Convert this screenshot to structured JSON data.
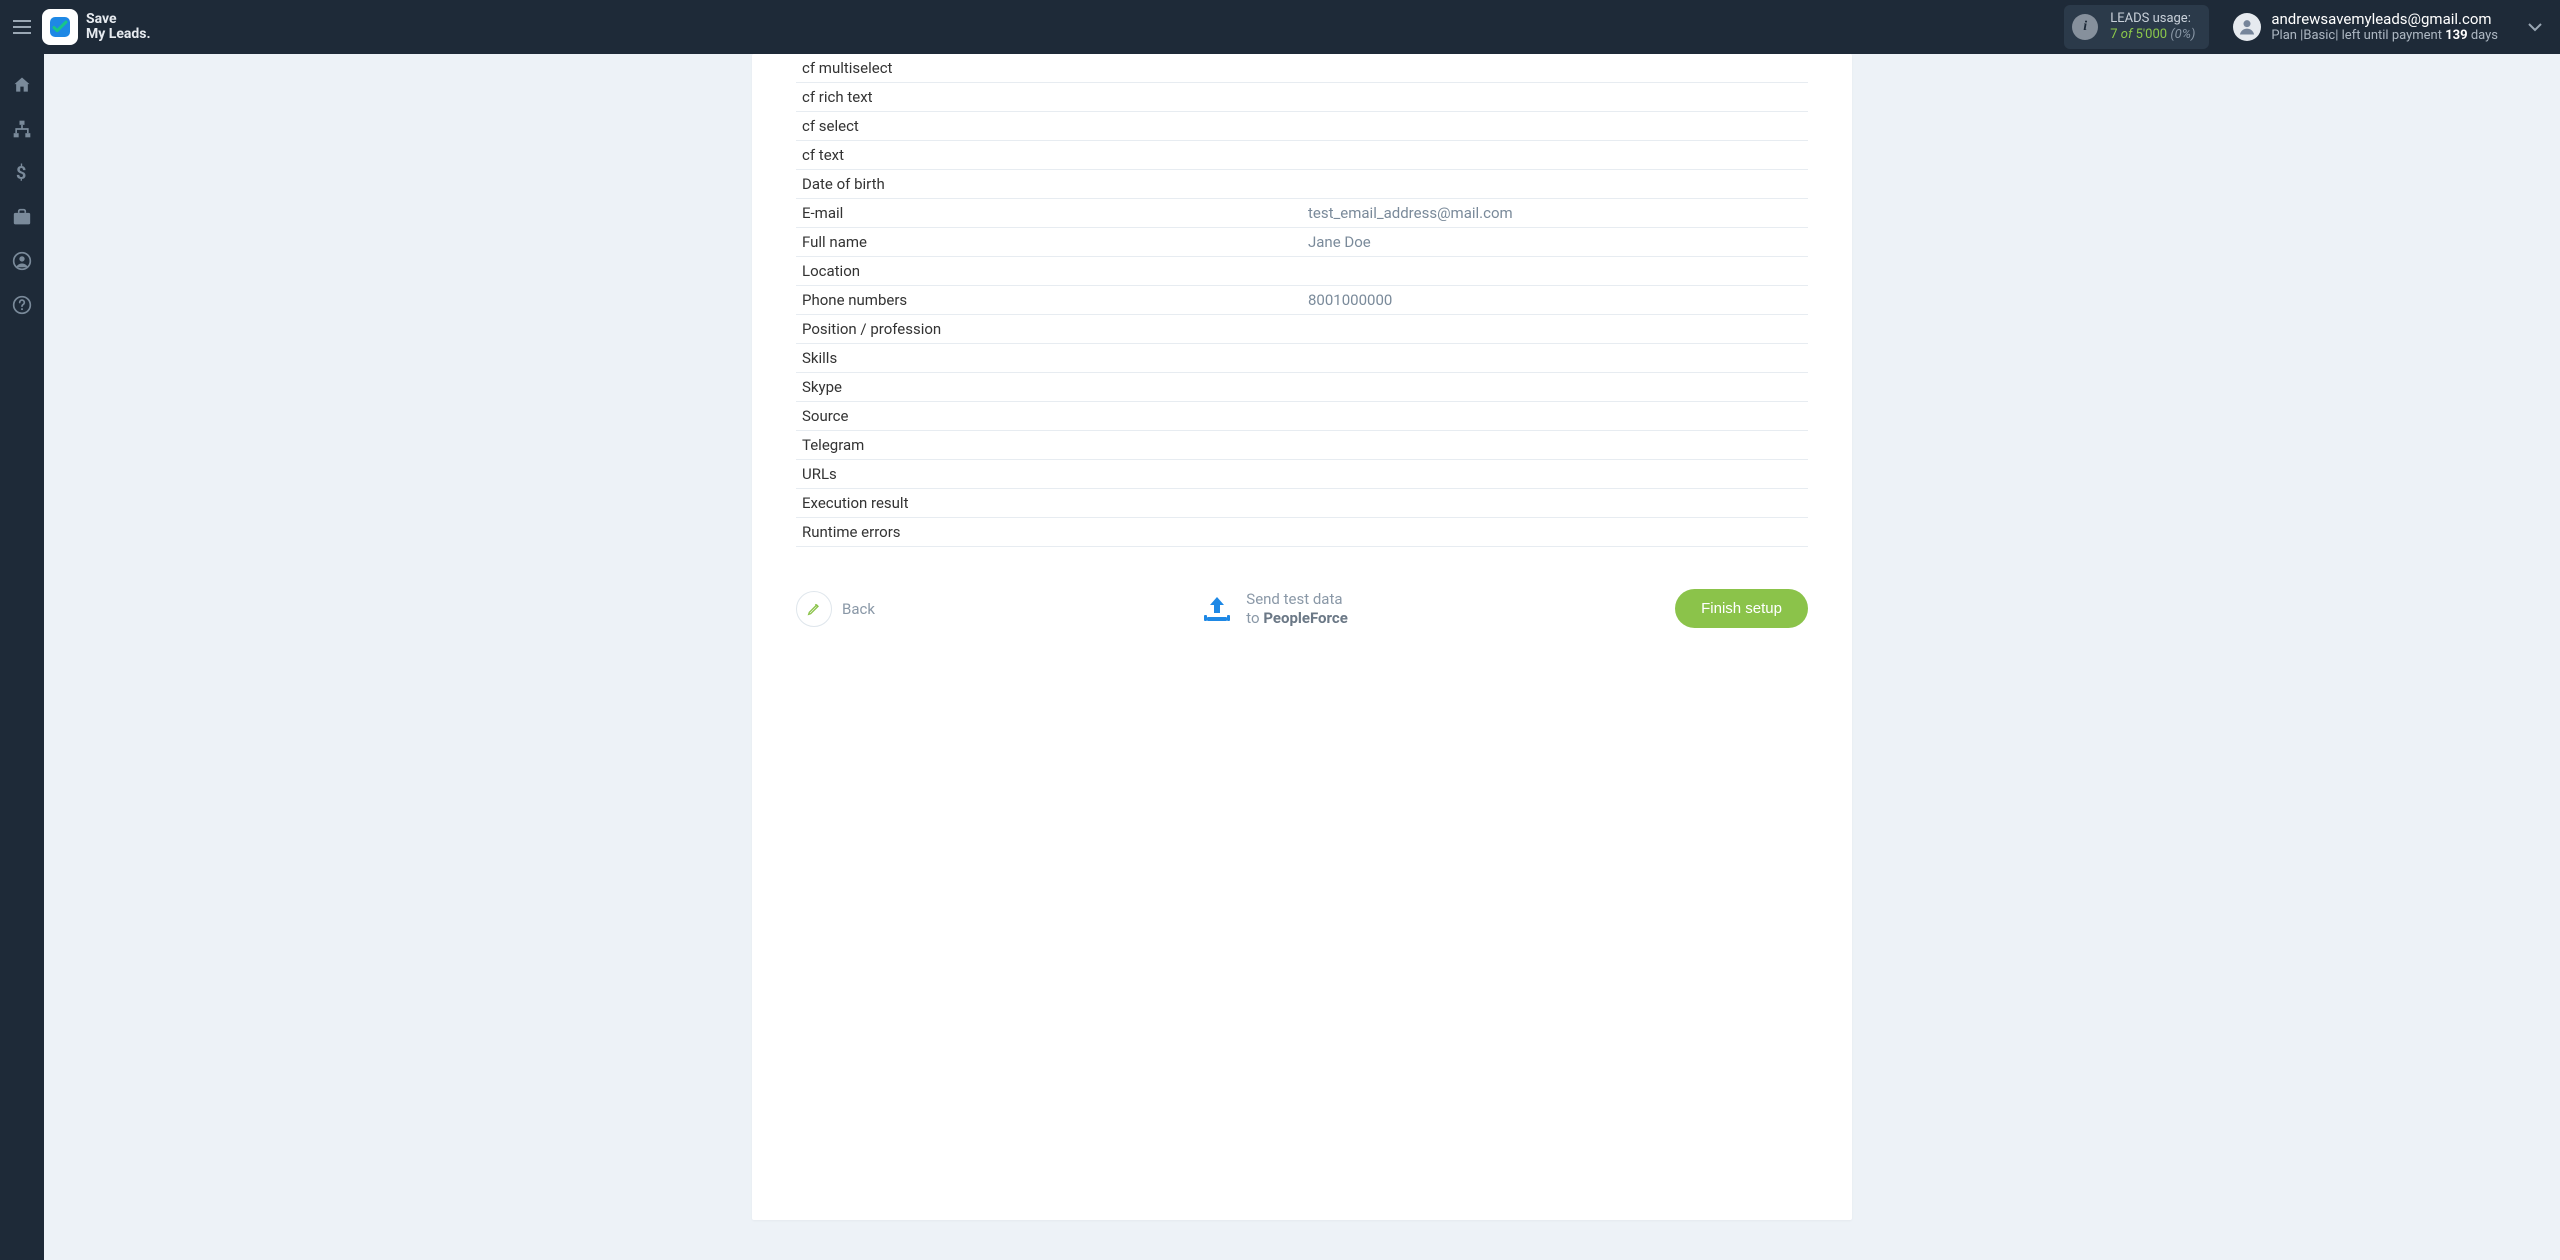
{
  "header": {
    "logo_line1": "Save",
    "logo_line2": "My Leads.",
    "usage_label": "LEADS usage:",
    "usage_used": "7",
    "usage_of": "of",
    "usage_limit": "5'000",
    "usage_pct": "(0%)",
    "user_email": "andrewsavemyleads@gmail.com",
    "plan_prefix": "Plan |",
    "plan_name": "Basic",
    "plan_mid": "| left until payment",
    "plan_days": "139",
    "plan_suffix": "days"
  },
  "rows": [
    {
      "label": "cf multiselect",
      "value": ""
    },
    {
      "label": "cf rich text",
      "value": ""
    },
    {
      "label": "cf select",
      "value": ""
    },
    {
      "label": "cf text",
      "value": ""
    },
    {
      "label": "Date of birth",
      "value": ""
    },
    {
      "label": "E-mail",
      "value": "test_email_address@mail.com"
    },
    {
      "label": "Full name",
      "value": "Jane Doe"
    },
    {
      "label": "Location",
      "value": ""
    },
    {
      "label": "Phone numbers",
      "value": "8001000000"
    },
    {
      "label": "Position / profession",
      "value": ""
    },
    {
      "label": "Skills",
      "value": ""
    },
    {
      "label": "Skype",
      "value": ""
    },
    {
      "label": "Source",
      "value": ""
    },
    {
      "label": "Telegram",
      "value": ""
    },
    {
      "label": "URLs",
      "value": ""
    },
    {
      "label": "Execution result",
      "value": ""
    },
    {
      "label": "Runtime errors",
      "value": ""
    }
  ],
  "footer": {
    "back_label": "Back",
    "send_line1": "Send test data",
    "send_line2_prefix": "to ",
    "send_line2_bold": "PeopleForce",
    "finish_label": "Finish setup"
  }
}
